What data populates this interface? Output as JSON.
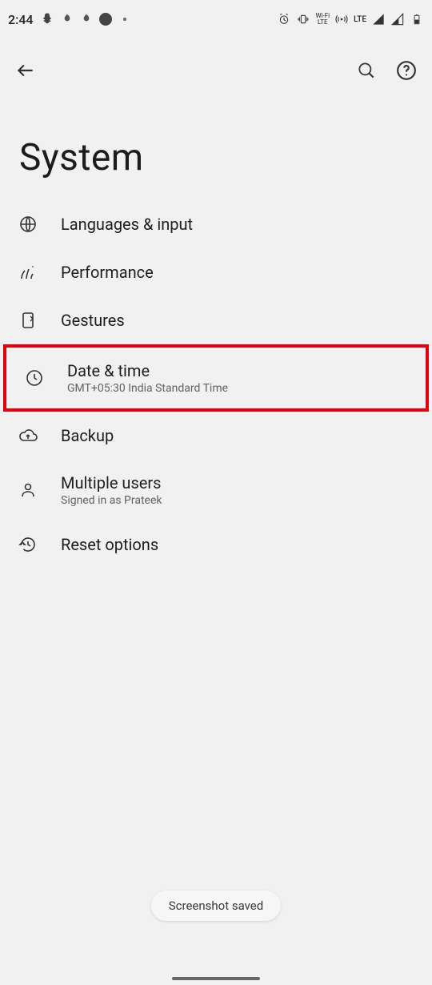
{
  "statusbar": {
    "time": "2:44",
    "lte_label": "LTE",
    "wifi_label": "Wifi LTE"
  },
  "page": {
    "title": "System"
  },
  "items": [
    {
      "icon": "globe-icon",
      "label": "Languages & input",
      "sub": ""
    },
    {
      "icon": "performance-icon",
      "label": "Performance",
      "sub": ""
    },
    {
      "icon": "gestures-icon",
      "label": "Gestures",
      "sub": ""
    },
    {
      "icon": "clock-icon",
      "label": "Date & time",
      "sub": "GMT+05:30 India Standard Time"
    },
    {
      "icon": "cloud-icon",
      "label": "Backup",
      "sub": ""
    },
    {
      "icon": "person-icon",
      "label": "Multiple users",
      "sub": "Signed in as Prateek"
    },
    {
      "icon": "history-icon",
      "label": "Reset options",
      "sub": ""
    }
  ],
  "toast": {
    "message": "Screenshot saved"
  },
  "highlight_index": 3
}
